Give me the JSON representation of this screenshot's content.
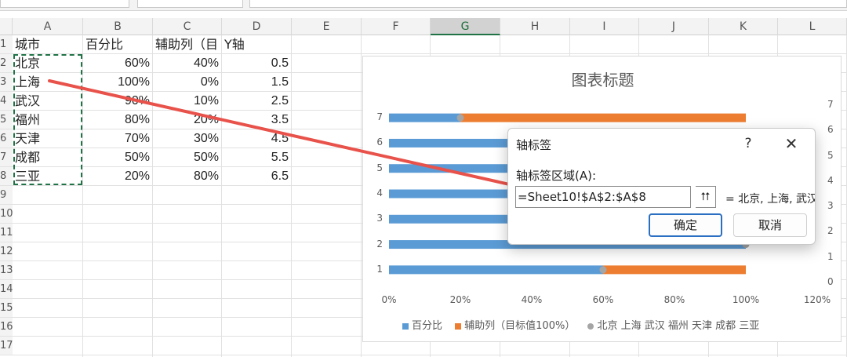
{
  "columns": [
    "A",
    "B",
    "C",
    "D",
    "E",
    "F",
    "G",
    "H",
    "I",
    "J",
    "K",
    "L"
  ],
  "selected_column": "G",
  "rows": [
    "1",
    "2",
    "3",
    "4",
    "5",
    "6",
    "7",
    "8",
    "9",
    "10",
    "11",
    "12",
    "13",
    "14",
    "15",
    "16",
    "17"
  ],
  "sheet": {
    "headers": [
      "城市",
      "百分比",
      "辅助列（目",
      "Y轴"
    ],
    "data": [
      [
        "北京",
        "60%",
        "40%",
        "0.5"
      ],
      [
        "上海",
        "100%",
        "0%",
        "1.5"
      ],
      [
        "武汉",
        "90%",
        "10%",
        "2.5"
      ],
      [
        "福州",
        "80%",
        "20%",
        "3.5"
      ],
      [
        "天津",
        "70%",
        "30%",
        "4.5"
      ],
      [
        "成都",
        "50%",
        "50%",
        "5.5"
      ],
      [
        "三亚",
        "20%",
        "80%",
        "6.5"
      ]
    ]
  },
  "chart": {
    "title": "图表标题",
    "y_ticks": [
      "1",
      "2",
      "3",
      "4",
      "5",
      "6",
      "7"
    ],
    "y2_ticks": [
      "0",
      "1",
      "2",
      "3",
      "4",
      "5",
      "6",
      "7"
    ],
    "x_ticks": [
      "0%",
      "20%",
      "40%",
      "60%",
      "80%",
      "100%",
      "120%"
    ],
    "legend": {
      "series1": "百分比",
      "series2": "辅助列（目标值100%）",
      "series3": "北京 上海 武汉 福州 天津 成都 三亚"
    },
    "colors": {
      "series1": "#5b9bd5",
      "series2": "#ed7d31",
      "series3": "#a5a5a5"
    }
  },
  "chart_data": {
    "type": "bar",
    "orientation": "horizontal",
    "stacked": true,
    "title": "图表标题",
    "categories": [
      "1",
      "2",
      "3",
      "4",
      "5",
      "6",
      "7"
    ],
    "series": [
      {
        "name": "百分比",
        "values": [
          0.6,
          1.0,
          0.9,
          0.8,
          0.7,
          0.5,
          0.2
        ]
      },
      {
        "name": "辅助列（目标值100%）",
        "values": [
          0.4,
          0.0,
          0.1,
          0.2,
          0.3,
          0.5,
          0.8
        ]
      }
    ],
    "scatter": {
      "name": "北京 上海 武汉 福州 天津 成都 三亚",
      "x": [
        0.6,
        1.0,
        0.9,
        0.8,
        0.7,
        0.5,
        0.2
      ],
      "y": [
        0.5,
        1.5,
        2.5,
        3.5,
        4.5,
        5.5,
        6.5
      ]
    },
    "xlim": [
      0,
      1.2
    ],
    "ylim_secondary": [
      0,
      7
    ],
    "legend_position": "bottom"
  },
  "dialog": {
    "title": "轴标签",
    "help": "?",
    "close": "✕",
    "range_label": "轴标签区域(A):",
    "range_value": "=Sheet10!$A$2:$A$8",
    "collapse_icon": "⮅",
    "preview": "= 北京, 上海, 武汉",
    "ok_label": "确定",
    "cancel_label": "取消"
  }
}
